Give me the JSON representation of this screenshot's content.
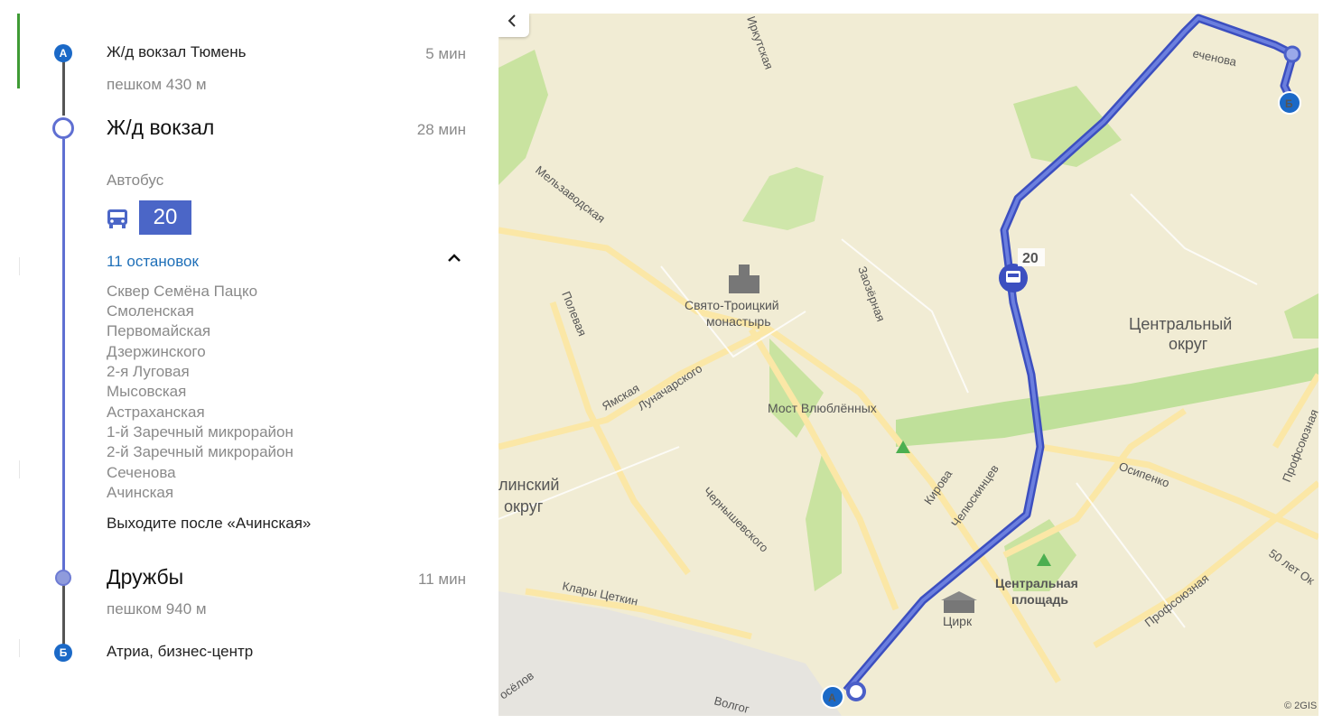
{
  "route": {
    "start": {
      "letter": "А",
      "name": "Ж/д вокзал Тюмень",
      "time": "5 мин",
      "walk": "пешком 430 м"
    },
    "board": {
      "name": "Ж/д вокзал",
      "time": "28 мин",
      "transport_type": "Автобус",
      "bus_number": "20",
      "stops_link": "11 остановок",
      "stops": [
        "Сквер Семёна Пацко",
        "Смоленская",
        "Первомайская",
        "Дзержинского",
        "2-я Луговая",
        "Мысовская",
        "Астраханская",
        "1-й Заречный микрорайон",
        "2-й Заречный микрорайон",
        "Сеченова",
        "Ачинская"
      ],
      "exit_note": "Выходите после «Ачинская»"
    },
    "alight": {
      "name": "Дружбы",
      "time": "11 мин",
      "walk": "пешком 940 м"
    },
    "end": {
      "letter": "Б",
      "name": "Атриа, бизнес-центр"
    }
  },
  "map": {
    "labels": {
      "street_irkutskaya": "Иркутская",
      "street_sechenova": "еченова",
      "street_melzavodskaya": "Мельзаводская",
      "street_polevaya": "Полевая",
      "street_zaozernaya": "Заозёрная",
      "street_yamskaya": "Ямская",
      "street_lunacharskogo": "Луначарского",
      "street_kirova": "Кирова",
      "street_chelyuskintsev": "Челюскинцев",
      "street_osipenko": "Осипенко",
      "street_profsoyuznaya_1": "Профсоюзная",
      "street_profsoyuznaya_2": "Профсоюзная",
      "street_chernyshevskogo": "Чернышевского",
      "street_klary_tsetkin": "Клары Цеткин",
      "street_50_let": "50 лет Ок",
      "street_novoselov": "осёлов",
      "street_volgo": "Волгог",
      "monastery_1": "Свято-Троицкий",
      "monastery_2": "монастырь",
      "bridge": "Мост Влюблённых",
      "district_central_1": "Центральный",
      "district_central_2": "округ",
      "district_kalinin_1": "линский",
      "district_kalinin_2": "округ",
      "square_1": "Центральная",
      "square_2": "площадь",
      "circus": "Цирк",
      "bus_route": "20",
      "marker_a": "А",
      "marker_b": "Б",
      "copyright": "© 2GIS"
    },
    "colors": {
      "route": "#4a5fc8",
      "base": "#f1ecd4",
      "park": "#c9e3a0",
      "road": "#fbe7a6"
    }
  }
}
